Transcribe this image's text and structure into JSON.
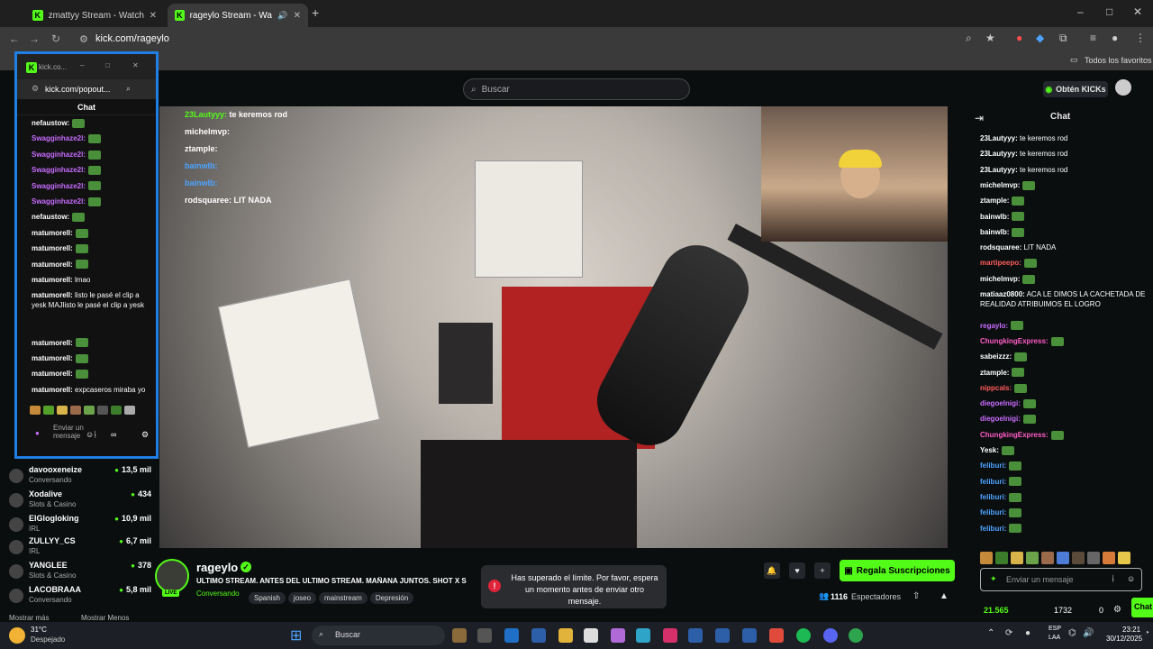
{
  "browser": {
    "tabs": [
      {
        "title": "zmattyy Stream - Watch Live o",
        "active": false
      },
      {
        "title": "rageylo Stream - Watch Live",
        "active": true
      }
    ],
    "new_tab": "+",
    "url": "kick.com/rageylo",
    "bookmarks_label": "Todos los favoritos",
    "window_controls": {
      "minimize": "–",
      "maximize": "□",
      "close": "✕"
    }
  },
  "kick": {
    "search_placeholder": "Buscar",
    "get_kicks": "Obtén KICKs",
    "accent": "#53fc18"
  },
  "popout": {
    "title": "kick.co...",
    "url": "kick.com/popout...",
    "chat_title": "Chat",
    "messages": [
      {
        "user": "nefaustow:",
        "text": "",
        "color": "#ffffff"
      },
      {
        "user": "Swagginhaze2l:",
        "text": "",
        "color": "#c86cff"
      },
      {
        "user": "Swagginhaze2l:",
        "text": "",
        "color": "#c86cff"
      },
      {
        "user": "Swagginhaze2l:",
        "text": "",
        "color": "#c86cff"
      },
      {
        "user": "Swagginhaze2l:",
        "text": "",
        "color": "#c86cff"
      },
      {
        "user": "Swagginhaze2l:",
        "text": "",
        "color": "#c86cff"
      },
      {
        "user": "nefaustow:",
        "text": "",
        "color": "#ffffff"
      },
      {
        "user": "matumorell:",
        "text": "",
        "color": "#ffffff"
      },
      {
        "user": "matumorell:",
        "text": "",
        "color": "#ffffff"
      },
      {
        "user": "matumorell:",
        "text": "",
        "color": "#ffffff"
      },
      {
        "user": "matumorell:",
        "text": "lmao",
        "color": "#ffffff"
      },
      {
        "user": "matumorell:",
        "text": "listo le pasé el clip a yesk MAJlisto le pasé el clip a yesk",
        "color": "#ffffff"
      },
      {
        "user": "matumorell:",
        "text": "",
        "color": "#ffffff"
      },
      {
        "user": "matumorell:",
        "text": "",
        "color": "#ffffff"
      },
      {
        "user": "matumorell:",
        "text": "",
        "color": "#ffffff"
      },
      {
        "user": "matumorell:",
        "text": "expcaseros miraba yo",
        "color": "#ffffff"
      }
    ],
    "input_placeholder": "Enviar un mensaje"
  },
  "sidebar": {
    "channels": [
      {
        "name": "davooxeneize",
        "category": "Conversando",
        "viewers": "13,5 mil"
      },
      {
        "name": "Xodalive",
        "category": "Slots & Casino",
        "viewers": "434"
      },
      {
        "name": "ElGlogloking",
        "category": "IRL",
        "viewers": "10,9 mil"
      },
      {
        "name": "ZULLYY_CS",
        "category": "IRL",
        "viewers": "6,7 mil"
      },
      {
        "name": "YANGLEE",
        "category": "Slots & Casino",
        "viewers": "378"
      },
      {
        "name": "LACOBRAAA",
        "category": "Conversando",
        "viewers": "5,8 mil"
      }
    ],
    "show_more": "Mostrar más",
    "show_less": "Mostrar Menos"
  },
  "video_overlay_chat": [
    {
      "user": "23Lautyyy:",
      "text": "te keremos rod",
      "color": "#53fc18"
    },
    {
      "user": "michelmvp:",
      "text": "",
      "color": "#ffffff"
    },
    {
      "user": "ztample:",
      "text": "",
      "color": "#ffffff"
    },
    {
      "user": "bainwlb:",
      "text": "",
      "color": "#4da3ff"
    },
    {
      "user": "bainwlb:",
      "text": "",
      "color": "#4da3ff"
    },
    {
      "user": "rodsquaree:",
      "text": "LIT NADA",
      "color": "#ffffff"
    }
  ],
  "stream": {
    "channel": "rageylo",
    "title": "ULTIMO STREAM. ANTES DEL ULTIMO STREAM. MAÑANA JUNTOS. SHOT X S",
    "category": "Conversando",
    "tags": [
      "Spanish",
      "joseo",
      "mainstream",
      "Depresión"
    ],
    "live_badge": "LIVE",
    "subscribe_label": "Regala Suscripciones",
    "viewers": "1116",
    "viewers_label": "Espectadores",
    "toast": "Has superado el límite. Por favor, espera un momento antes de enviar otro mensaje."
  },
  "chat": {
    "title": "Chat",
    "messages": [
      {
        "user": "23Lautyyy:",
        "text": "te keremos rod",
        "color": "#ffffff"
      },
      {
        "user": "23Lautyyy:",
        "text": "te keremos rod",
        "color": "#ffffff"
      },
      {
        "user": "23Lautyyy:",
        "text": "te keremos rod",
        "color": "#ffffff"
      },
      {
        "user": "michelmvp:",
        "text": "",
        "color": "#ffffff"
      },
      {
        "user": "ztample:",
        "text": "",
        "color": "#ffffff"
      },
      {
        "user": "bainwlb:",
        "text": "",
        "color": "#ffffff"
      },
      {
        "user": "bainwlb:",
        "text": "",
        "color": "#ffffff"
      },
      {
        "user": "rodsquaree:",
        "text": "LIT NADA",
        "color": "#ffffff"
      },
      {
        "user": "martipeepo:",
        "text": "",
        "color": "#ff5c5c"
      },
      {
        "user": "michelmvp:",
        "text": "",
        "color": "#ffffff"
      },
      {
        "user": "matiaaz0800:",
        "text": "ACA LE DIMOS LA CACHETADA DE REALIDAD ATRIBUIMOS EL LOGRO",
        "color": "#ffffff"
      },
      {
        "user": "regaylo:",
        "text": "",
        "color": "#c86cff"
      },
      {
        "user": "ChungkingExpress:",
        "text": "",
        "color": "#ff5cc8"
      },
      {
        "user": "sabeizzz:",
        "text": "",
        "color": "#ffffff"
      },
      {
        "user": "ztample:",
        "text": "",
        "color": "#ffffff"
      },
      {
        "user": "nippcals:",
        "text": "",
        "color": "#ff5c5c"
      },
      {
        "user": "diegoelnigi:",
        "text": "",
        "color": "#c86cff"
      },
      {
        "user": "diegoelnigi:",
        "text": "",
        "color": "#c86cff"
      },
      {
        "user": "ChungkingExpress:",
        "text": "",
        "color": "#ff5cc8"
      },
      {
        "user": "Yesk:",
        "text": "",
        "color": "#ffffff"
      },
      {
        "user": "feliburi:",
        "text": "",
        "color": "#4da3ff"
      },
      {
        "user": "feliburi:",
        "text": "",
        "color": "#4da3ff"
      },
      {
        "user": "feliburi:",
        "text": "",
        "color": "#4da3ff"
      },
      {
        "user": "feliburi:",
        "text": "",
        "color": "#4da3ff"
      },
      {
        "user": "feliburi:",
        "text": "",
        "color": "#4da3ff"
      }
    ],
    "input_placeholder": "Enviar un mensaje",
    "kicks_balance": "21.565",
    "points": "1732",
    "zero": "0",
    "chat_button": "Chat"
  },
  "taskbar": {
    "weather_temp": "31°C",
    "weather_desc": "Despejado",
    "search": "Buscar",
    "lang": "ESP",
    "region": "LAA",
    "time": "23:21",
    "date": "30/12/2025"
  }
}
